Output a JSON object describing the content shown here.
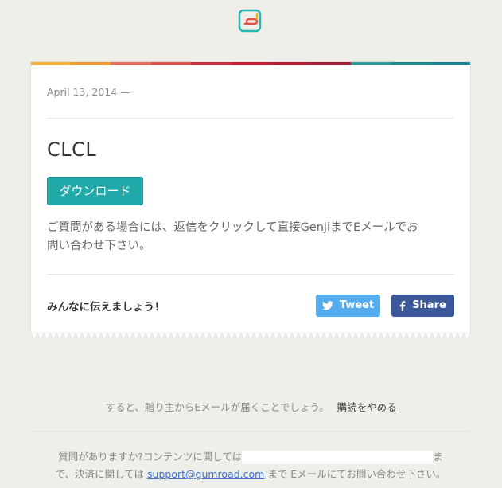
{
  "header": {
    "logo_icon": "gumroad-logo-icon"
  },
  "card": {
    "stripe_colors": [
      "#f2b02f",
      "#f09a2c",
      "#ec6a5c",
      "#e0504e",
      "#d0303f",
      "#c81d34",
      "#b51d33",
      "#a51c39",
      "#2a9a9a",
      "#1f8d8f",
      "#1c8290"
    ],
    "date": "April 13, 2014 —",
    "product_title": "CLCL",
    "download_label": "ダウンロード",
    "help_text": "ご質問がある場合には、返信をクリックして直接Genjiまでお問い合わせ下さい。",
    "help_text_line1": "ご質問がある場合には、返信をクリックして直接GenjiまでEメールでお",
    "help_text_line2": "問い合わせ下さい。",
    "share_label": "みんなに伝えましょう！",
    "tweet_label": "Tweet",
    "share_button_label": "Share"
  },
  "footer": {
    "notice": "すると、贈り主からEメールが届くことでしょう。",
    "unsubscribe_label": "購読をやめる",
    "contact_part1": "質問がありますか?コンテンツに関しては",
    "contact_part2": "ま",
    "contact_part3": "で、決済に関しては",
    "support_email": "support@gumroad.com",
    "contact_part4": "まで Eメールにてお問い合わせ下さい。"
  }
}
